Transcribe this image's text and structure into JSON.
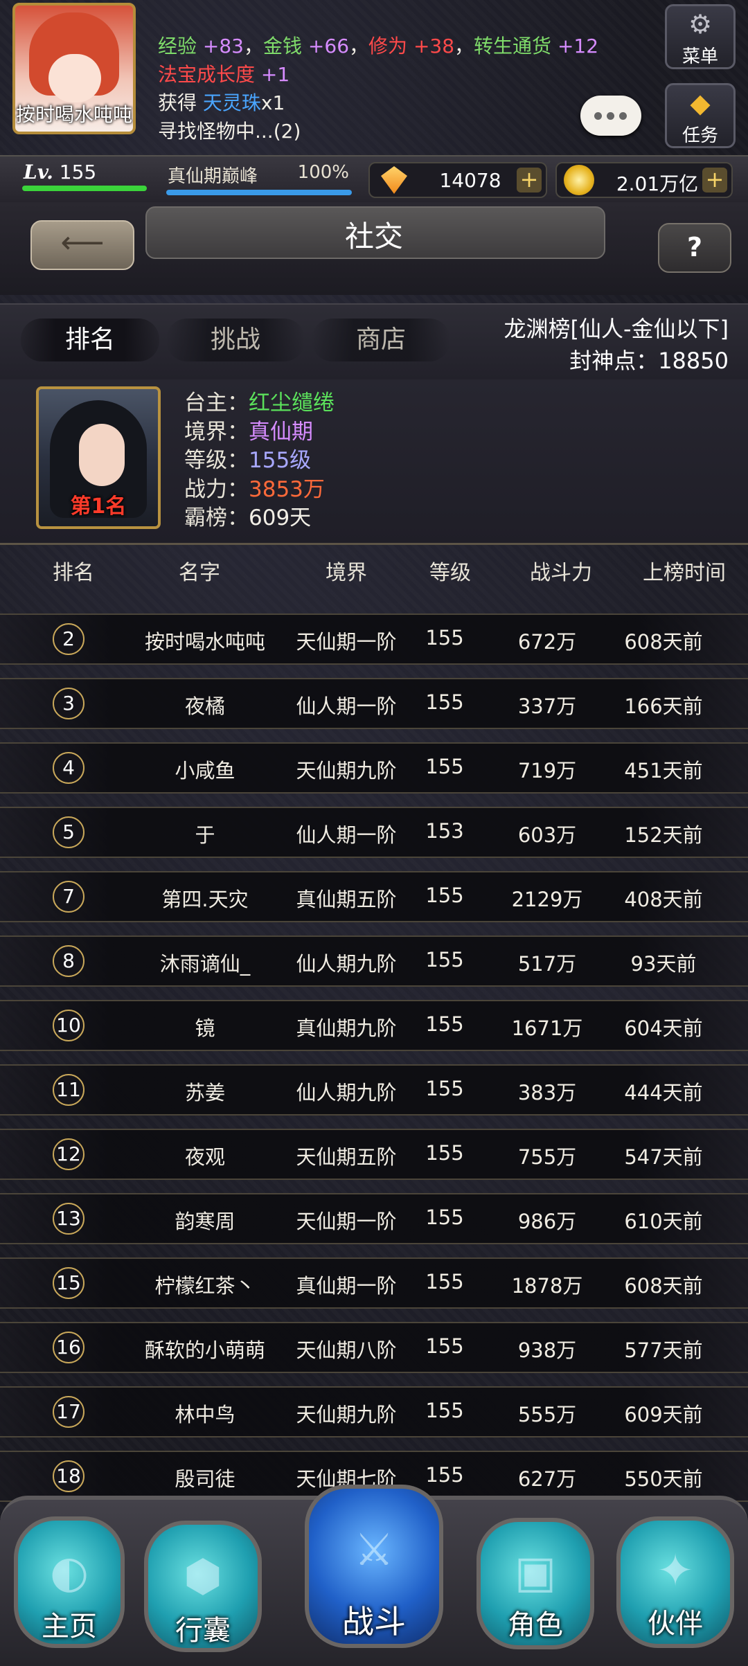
{
  "player": {
    "name": "按时喝水吨吨",
    "level_label": "Lv.",
    "level": "155",
    "realm": "真仙期巅峰",
    "realm_progress": "100%",
    "gems": "14078",
    "gold": "2.01万亿"
  },
  "log": {
    "line1": [
      {
        "t": "经验 ",
        "c": "c-green"
      },
      {
        "t": "+83",
        "c": "c-purple"
      },
      {
        "t": "，",
        "c": "c-white"
      },
      {
        "t": "金钱 ",
        "c": "c-green"
      },
      {
        "t": "+66",
        "c": "c-purple"
      },
      {
        "t": "，",
        "c": "c-white"
      },
      {
        "t": "修为 ",
        "c": "c-red"
      },
      {
        "t": "+38",
        "c": "c-red"
      },
      {
        "t": "，",
        "c": "c-white"
      },
      {
        "t": "转生通货 ",
        "c": "c-green"
      },
      {
        "t": "+12",
        "c": "c-purple"
      }
    ],
    "line2_label": "法宝成长度",
    "line2_value": "+1",
    "line3_prefix": "获得 ",
    "line3_item": "天灵珠",
    "line3_suffix": "x1",
    "line4": "寻找怪物中...(2)"
  },
  "hud": {
    "menu_label": "菜单",
    "menu_icon": "gear-icon",
    "task_label": "任务",
    "task_icon": "gem-icon"
  },
  "title": "社交",
  "tabs": [
    {
      "label": "排名",
      "active": true
    },
    {
      "label": "挑战",
      "active": false
    },
    {
      "label": "商店",
      "active": false
    }
  ],
  "board": {
    "name": "龙渊榜[仙人-金仙以下]",
    "points_label": "封神点：18850"
  },
  "champion": {
    "rank_label": "第1名",
    "owner_key": "台主：",
    "owner": "红尘缱绻",
    "realm_key": "境界：",
    "realm": "真仙期",
    "level_key": "等级：",
    "level": "155级",
    "power_key": "战力：",
    "power": "3853万",
    "reign_key": "霸榜：",
    "reign": "609天"
  },
  "columns": [
    "排名",
    "名字",
    "境界",
    "等级",
    "战斗力",
    "上榜时间"
  ],
  "rows": [
    {
      "rank": "2",
      "name": "按时喝水吨吨",
      "realm": "天仙期一阶",
      "level": "155",
      "power": "672万",
      "time": "608天前"
    },
    {
      "rank": "3",
      "name": "夜橘",
      "realm": "仙人期一阶",
      "level": "155",
      "power": "337万",
      "time": "166天前"
    },
    {
      "rank": "4",
      "name": "小咸鱼",
      "realm": "天仙期九阶",
      "level": "155",
      "power": "719万",
      "time": "451天前"
    },
    {
      "rank": "5",
      "name": "于",
      "realm": "仙人期一阶",
      "level": "153",
      "power": "603万",
      "time": "152天前"
    },
    {
      "rank": "7",
      "name": "第四.天灾",
      "realm": "真仙期五阶",
      "level": "155",
      "power": "2129万",
      "time": "408天前"
    },
    {
      "rank": "8",
      "name": "沐雨谪仙_",
      "realm": "仙人期九阶",
      "level": "155",
      "power": "517万",
      "time": "93天前"
    },
    {
      "rank": "10",
      "name": "镜",
      "realm": "真仙期九阶",
      "level": "155",
      "power": "1671万",
      "time": "604天前"
    },
    {
      "rank": "11",
      "name": "苏姜",
      "realm": "仙人期九阶",
      "level": "155",
      "power": "383万",
      "time": "444天前"
    },
    {
      "rank": "12",
      "name": "夜观",
      "realm": "天仙期五阶",
      "level": "155",
      "power": "755万",
      "time": "547天前"
    },
    {
      "rank": "13",
      "name": "韵寒周",
      "realm": "天仙期一阶",
      "level": "155",
      "power": "986万",
      "time": "610天前"
    },
    {
      "rank": "15",
      "name": "柠檬红茶丶",
      "realm": "真仙期一阶",
      "level": "155",
      "power": "1878万",
      "time": "608天前"
    },
    {
      "rank": "16",
      "name": "酥软的小萌萌",
      "realm": "天仙期八阶",
      "level": "155",
      "power": "938万",
      "time": "577天前"
    },
    {
      "rank": "17",
      "name": "林中鸟",
      "realm": "天仙期九阶",
      "level": "155",
      "power": "555万",
      "time": "609天前"
    },
    {
      "rank": "18",
      "name": "殷司徒",
      "realm": "天仙期七阶",
      "level": "155",
      "power": "627万",
      "time": "550天前"
    }
  ],
  "nav": [
    {
      "label": "主页",
      "icon": "home-icon"
    },
    {
      "label": "行囊",
      "icon": "bag-icon"
    },
    {
      "label": "战斗",
      "icon": "sword-icon"
    },
    {
      "label": "角色",
      "icon": "chest-icon"
    },
    {
      "label": "伙伴",
      "icon": "partner-icon"
    }
  ]
}
